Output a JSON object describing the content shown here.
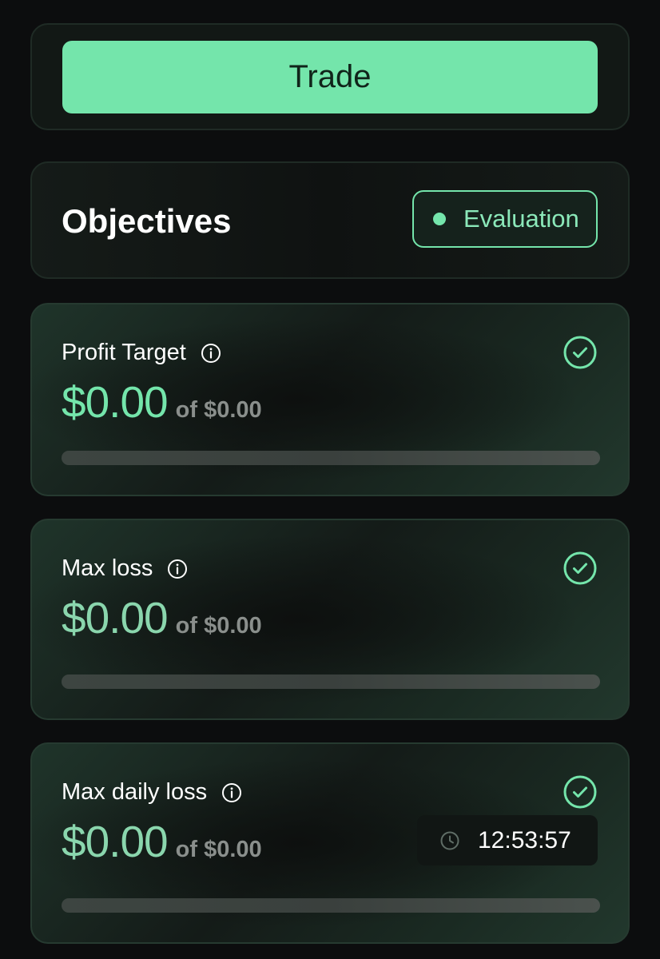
{
  "trade": {
    "button_label": "Trade"
  },
  "objectives": {
    "title": "Objectives",
    "status": "Evaluation"
  },
  "items": [
    {
      "label": "Profit Target",
      "value": "$0.00",
      "of_text": "of $0.00",
      "progress_percent": 0,
      "completed": true
    },
    {
      "label": "Max loss",
      "value": "$0.00",
      "of_text": "of $0.00",
      "progress_percent": 0,
      "completed": true
    },
    {
      "label": "Max daily loss",
      "value": "$0.00",
      "of_text": "of $0.00",
      "progress_percent": 0,
      "completed": true,
      "timer": "12:53:57"
    }
  ],
  "colors": {
    "accent": "#74e5ab",
    "background": "#0c0d0e",
    "muted_text": "#8a8f8c"
  },
  "icons": {
    "info": "info-circle-icon",
    "check": "check-circle-icon",
    "clock": "clock-icon",
    "status": "status-dot"
  }
}
